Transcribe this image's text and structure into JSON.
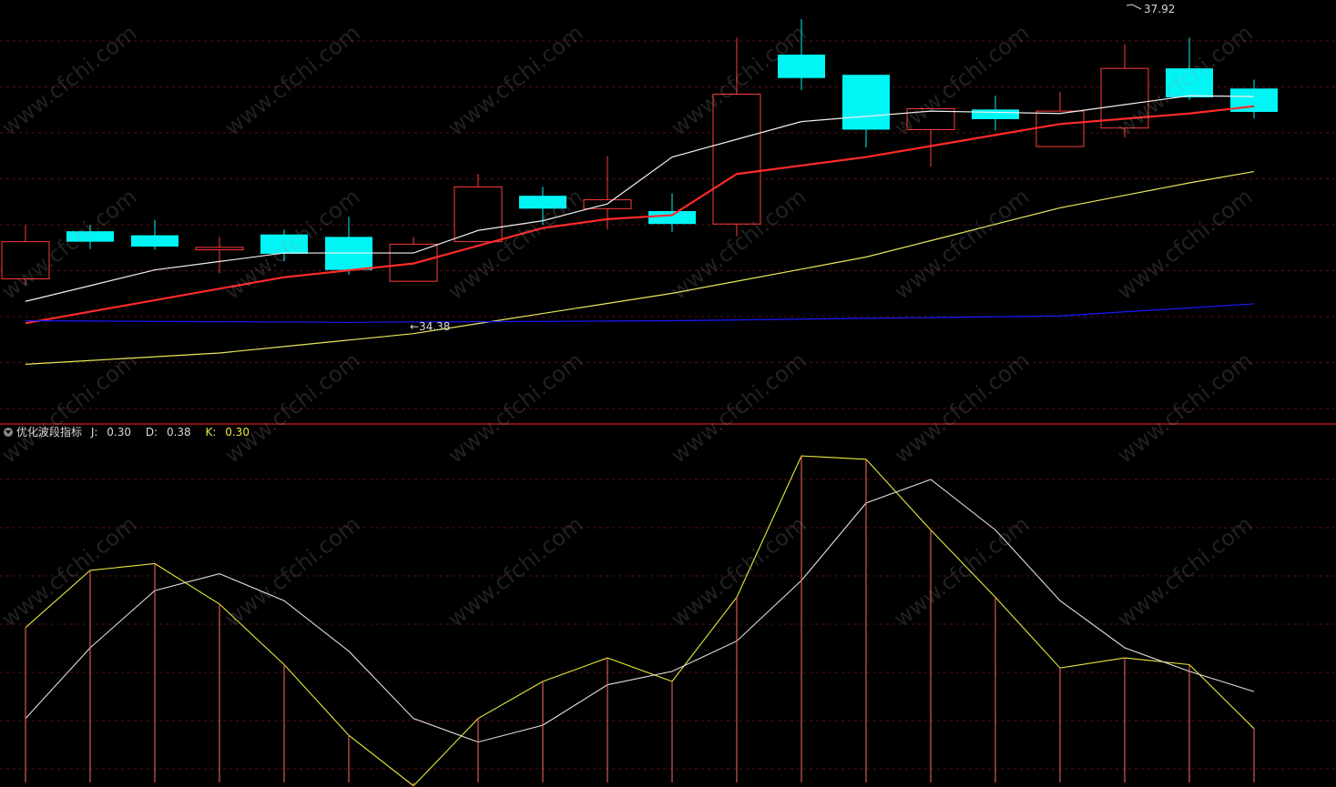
{
  "chart_data": [
    {
      "type": "candlestick",
      "panel": "main",
      "price_range": [
        33.3,
        38.4
      ],
      "candles": [
        {
          "open": 35.01,
          "close": 35.47,
          "high": 35.68,
          "low": 34.93
        },
        {
          "open": 35.6,
          "close": 35.47,
          "high": 35.68,
          "low": 35.38
        },
        {
          "open": 35.55,
          "close": 35.41,
          "high": 35.74,
          "low": 35.37
        },
        {
          "open": 35.37,
          "close": 35.4,
          "high": 35.53,
          "low": 35.08
        },
        {
          "open": 35.56,
          "close": 35.32,
          "high": 35.62,
          "low": 35.23
        },
        {
          "open": 35.53,
          "close": 35.12,
          "high": 35.78,
          "low": 35.06
        },
        {
          "open": 34.98,
          "close": 35.44,
          "high": 35.53,
          "low": 34.98
        },
        {
          "open": 35.47,
          "close": 36.15,
          "high": 36.31,
          "low": 35.47
        },
        {
          "open": 36.04,
          "close": 35.88,
          "high": 36.15,
          "low": 35.68
        },
        {
          "open": 35.88,
          "close": 35.99,
          "high": 36.53,
          "low": 35.62
        },
        {
          "open": 35.85,
          "close": 35.69,
          "high": 36.07,
          "low": 35.59
        },
        {
          "open": 35.69,
          "close": 37.3,
          "high": 38.0,
          "low": 35.54
        },
        {
          "open": 37.79,
          "close": 37.5,
          "high": 38.23,
          "low": 37.35
        },
        {
          "open": 37.54,
          "close": 36.86,
          "high": 37.54,
          "low": 36.64
        },
        {
          "open": 36.86,
          "close": 37.12,
          "high": 37.12,
          "low": 36.4
        },
        {
          "open": 37.11,
          "close": 36.99,
          "high": 37.28,
          "low": 36.85
        },
        {
          "open": 36.65,
          "close": 37.09,
          "high": 37.33,
          "low": 36.65
        },
        {
          "open": 36.88,
          "close": 37.62,
          "high": 37.92,
          "low": 36.76
        },
        {
          "open": 37.62,
          "close": 37.26,
          "high": 38.0,
          "low": 37.23
        },
        {
          "open": 37.37,
          "close": 37.08,
          "high": 37.48,
          "low": 37.0
        }
      ],
      "series": [
        {
          "name": "MA5",
          "color": "#f0f0f0",
          "values": [
            34.73,
            null,
            35.12,
            null,
            35.33,
            null,
            35.33,
            35.61,
            35.73,
            35.94,
            36.52,
            null,
            36.96,
            null,
            37.09,
            null,
            37.06,
            null,
            37.28,
            37.27
          ]
        },
        {
          "name": "MA10",
          "color": "#ff2a2a",
          "values": [
            34.46,
            null,
            null,
            null,
            35.03,
            null,
            35.2,
            null,
            35.64,
            35.75,
            35.8,
            36.31,
            null,
            36.52,
            null,
            null,
            36.93,
            null,
            37.06,
            37.15
          ]
        },
        {
          "name": "MA20",
          "color": "#e8e85a",
          "values": [
            33.95,
            null,
            null,
            34.09,
            null,
            null,
            34.33,
            null,
            null,
            null,
            34.83,
            null,
            null,
            35.28,
            null,
            null,
            35.89,
            null,
            36.2,
            36.34
          ]
        },
        {
          "name": "MA60",
          "color": "#1a1aff",
          "values": [
            34.49,
            null,
            null,
            null,
            null,
            34.47,
            null,
            null,
            null,
            null,
            34.49,
            null,
            null,
            null,
            null,
            null,
            34.55,
            null,
            null,
            34.7
          ]
        }
      ],
      "annotations": [
        {
          "text": "←34.38",
          "x_index": 6
        },
        {
          "text": "37.92",
          "x_index": 17
        }
      ]
    },
    {
      "type": "line",
      "panel": "indicator",
      "title": "优化波段指标",
      "legend": [
        {
          "label": "J:",
          "value": "0.30"
        },
        {
          "label": "D:",
          "value": "0.38"
        },
        {
          "label": "K:",
          "value": "0.30"
        }
      ],
      "ylim": [
        0,
        1.0
      ],
      "series": [
        {
          "name": "K",
          "color": "#e8e83c",
          "values": [
            0.46,
            0.63,
            0.65,
            0.53,
            0.35,
            0.14,
            -0.01,
            0.19,
            0.3,
            0.37,
            0.3,
            0.55,
            0.97,
            0.96,
            0.75,
            0.55,
            0.34,
            0.37,
            0.35,
            0.16
          ]
        },
        {
          "name": "D",
          "color": "#e0e0e0",
          "values": [
            0.19,
            0.4,
            0.57,
            0.62,
            0.54,
            0.39,
            0.19,
            0.12,
            0.17,
            0.29,
            0.33,
            0.42,
            0.6,
            0.83,
            0.9,
            0.75,
            0.54,
            0.4,
            0.33,
            0.27
          ]
        },
        {
          "name": "J",
          "color": "#ff6a6a",
          "type": "bar",
          "values": [
            0.46,
            0.63,
            0.65,
            0.53,
            0.35,
            0.14,
            -0.01,
            0.19,
            0.3,
            0.37,
            0.3,
            0.55,
            0.97,
            0.96,
            0.75,
            0.55,
            0.34,
            0.37,
            0.35,
            0.16
          ]
        }
      ]
    }
  ],
  "watermark": "www.cfchi.com"
}
